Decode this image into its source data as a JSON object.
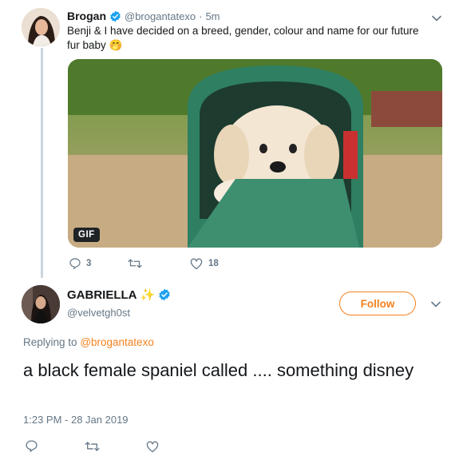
{
  "colors": {
    "accent": "#f5821f",
    "verified": "#1da1f2",
    "muted": "#657786"
  },
  "original_tweet": {
    "author_name": "Brogan",
    "handle": "@brogantatexo",
    "separator": "·",
    "time": "5m",
    "text": "Benji & I have decided on a breed, gender, colour and name for our future fur baby",
    "emoji": "🤭",
    "media_badge": "GIF",
    "reply_count": "3",
    "like_count": "18"
  },
  "reply_tweet": {
    "author_name": "GABRIELLA",
    "name_emoji": "✨",
    "handle": "@velvetgh0st",
    "follow_label": "Follow",
    "replying_to_prefix": "Replying to",
    "replying_to_handle": "@brogantatexo",
    "text": "a black female spaniel called .... something disney",
    "timestamp": "1:23 PM - 28 Jan 2019"
  },
  "icons": {
    "verified": "verified-badge-icon",
    "caret": "chevron-down-icon",
    "reply": "reply-icon",
    "retweet": "retweet-icon",
    "like": "heart-icon"
  }
}
